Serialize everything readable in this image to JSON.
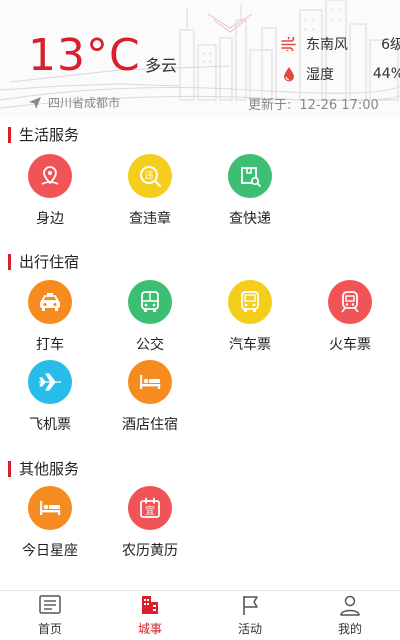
{
  "weather": {
    "temperature": "13°C",
    "condition": "多云",
    "wind_label": "东南风",
    "wind_value": "6级",
    "humidity_label": "湿度",
    "humidity_value": "44%",
    "location": "四川省成都市",
    "updated_label": "更新于:",
    "updated_time": "12-26 17:00"
  },
  "colors": {
    "accent": "#d7202a",
    "red": "#f05457",
    "yellow": "#f5cd1c",
    "green": "#3cbe73",
    "orange": "#f68b1f",
    "cyan": "#27bde8"
  },
  "sections": {
    "life": {
      "title": "生活服务",
      "items": [
        {
          "label": "身边",
          "icon": "location-pin-icon",
          "color": "red"
        },
        {
          "label": "查违章",
          "icon": "traffic-violation-search-icon",
          "color": "yellow"
        },
        {
          "label": "查快递",
          "icon": "package-search-icon",
          "color": "green"
        }
      ]
    },
    "travel": {
      "title": "出行住宿",
      "items": [
        {
          "label": "打车",
          "icon": "taxi-icon",
          "color": "orange"
        },
        {
          "label": "公交",
          "icon": "bus-icon",
          "color": "green"
        },
        {
          "label": "汽车票",
          "icon": "coach-icon",
          "color": "yellow"
        },
        {
          "label": "火车票",
          "icon": "train-icon",
          "color": "red"
        },
        {
          "label": "飞机票",
          "icon": "airplane-icon",
          "color": "cyan"
        },
        {
          "label": "酒店住宿",
          "icon": "hotel-bed-icon",
          "color": "orange"
        }
      ]
    },
    "other": {
      "title": "其他服务",
      "items": [
        {
          "label": "今日星座",
          "icon": "bed-icon",
          "color": "orange"
        },
        {
          "label": "农历黄历",
          "icon": "calendar-yi-icon",
          "color": "red",
          "glyph": "宜"
        }
      ]
    }
  },
  "tabbar": {
    "items": [
      {
        "label": "首页",
        "icon": "news-list-icon",
        "active": false
      },
      {
        "label": "城事",
        "icon": "city-building-icon",
        "active": true
      },
      {
        "label": "活动",
        "icon": "flag-icon",
        "active": false
      },
      {
        "label": "我的",
        "icon": "user-profile-icon",
        "active": false
      }
    ]
  }
}
